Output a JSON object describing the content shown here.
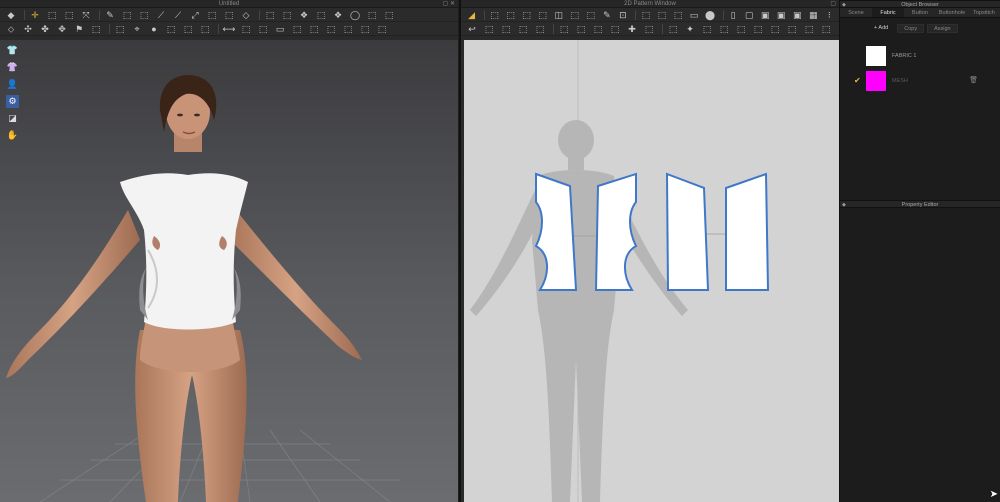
{
  "window_3d": {
    "title": "Untitled",
    "controls": "▢ ✕",
    "toolbar_row1": [
      "◆",
      "✛",
      "⬚",
      "⬚",
      "⤧",
      "✎",
      "⬚",
      "⬚",
      "⟋",
      "⟋",
      "⤢",
      "⬚",
      "⬚",
      "◇",
      "⬚",
      "⬚",
      "❖",
      "⬚",
      "❖",
      "◯",
      "⬚",
      "⬚"
    ],
    "toolbar_row2": [
      "⬦",
      "✣",
      "✤",
      "✥",
      "⚑",
      "⬚",
      "⬚",
      "⌖",
      "●",
      "⬚",
      "⬚",
      "⬚",
      "⟷",
      "⬚",
      "⬚",
      "▭",
      "⬚",
      "⬚",
      "⬚",
      "⬚",
      "⬚",
      "⬚"
    ],
    "side_tools": [
      "👕",
      "👚",
      "👤",
      "⚙",
      "◪",
      "✋"
    ]
  },
  "window_2d": {
    "title": "2D Pattern Window",
    "controls": "▢",
    "toolbar_row1": [
      "◢",
      "⬚",
      "⬚",
      "⬚",
      "⬚",
      "◫",
      "⬚",
      "⬚",
      "✎",
      "⊡",
      "⬚",
      "⬚",
      "⬚",
      "▭",
      "⬤",
      "▯",
      "▢",
      "▣",
      "▣",
      "▣",
      "▦",
      "⁝"
    ],
    "toolbar_row2": [
      "↩",
      "⬚",
      "⬚",
      "⬚",
      "⬚",
      "⬚",
      "⬚",
      "⬚",
      "⬚",
      "✚",
      "⬚",
      "⬚",
      "✦",
      "⬚",
      "⬚",
      "⬚",
      "⬚",
      "⬚",
      "⬚",
      "⬚",
      "⬚"
    ]
  },
  "object_browser": {
    "title": "Object Browser",
    "tabs": [
      "Scene",
      "Fabric",
      "Button",
      "Buttonhole",
      "Topstitch"
    ],
    "active_tab": "Fabric",
    "actions": {
      "add": "+ Add",
      "copy": "Copy",
      "assign": "Assign"
    },
    "fabrics": [
      {
        "name": "FABRIC 1",
        "color": "#ffffff",
        "selected": false
      },
      {
        "name": "MESH",
        "color": "#ff00ff",
        "selected": true
      }
    ]
  },
  "property_editor": {
    "title": "Property Editor"
  },
  "colors": {
    "accent": "#e7b53d",
    "selected_tool": "#3a5ea0",
    "pattern_outline": "#3f78c8"
  }
}
